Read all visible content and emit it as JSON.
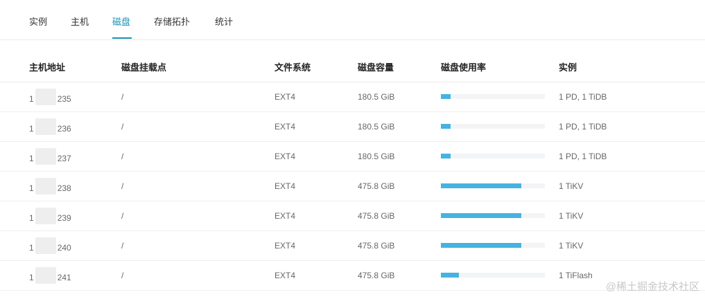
{
  "tabs": [
    {
      "label": "实例"
    },
    {
      "label": "主机"
    },
    {
      "label": "磁盘",
      "active": true
    },
    {
      "label": "存储拓扑"
    },
    {
      "label": "统计"
    }
  ],
  "columns": [
    "主机地址",
    "磁盘挂载点",
    "文件系统",
    "磁盘容量",
    "磁盘使用率",
    "实例"
  ],
  "rows": [
    {
      "ip_prefix": "1",
      "ip_suffix": "235",
      "mount": "/",
      "fs": "EXT4",
      "capacity": "180.5 GiB",
      "usage": 0.09,
      "instances": "1 PD, 1 TiDB"
    },
    {
      "ip_prefix": "1",
      "ip_suffix": "236",
      "mount": "/",
      "fs": "EXT4",
      "capacity": "180.5 GiB",
      "usage": 0.09,
      "instances": "1 PD, 1 TiDB"
    },
    {
      "ip_prefix": "1",
      "ip_suffix": "237",
      "mount": "/",
      "fs": "EXT4",
      "capacity": "180.5 GiB",
      "usage": 0.09,
      "instances": "1 PD, 1 TiDB"
    },
    {
      "ip_prefix": "1",
      "ip_suffix": "238",
      "mount": "/",
      "fs": "EXT4",
      "capacity": "475.8 GiB",
      "usage": 0.77,
      "instances": "1 TiKV"
    },
    {
      "ip_prefix": "1",
      "ip_suffix": "239",
      "mount": "/",
      "fs": "EXT4",
      "capacity": "475.8 GiB",
      "usage": 0.77,
      "instances": "1 TiKV"
    },
    {
      "ip_prefix": "1",
      "ip_suffix": "240",
      "mount": "/",
      "fs": "EXT4",
      "capacity": "475.8 GiB",
      "usage": 0.77,
      "instances": "1 TiKV"
    },
    {
      "ip_prefix": "1",
      "ip_suffix": "241",
      "mount": "/",
      "fs": "EXT4",
      "capacity": "475.8 GiB",
      "usage": 0.17,
      "instances": "1 TiFlash"
    }
  ],
  "colors": {
    "accent": "#1890b8",
    "bar": "#45b3e0",
    "track": "#f2f4f6"
  },
  "watermark": "@稀土掘金技术社区"
}
